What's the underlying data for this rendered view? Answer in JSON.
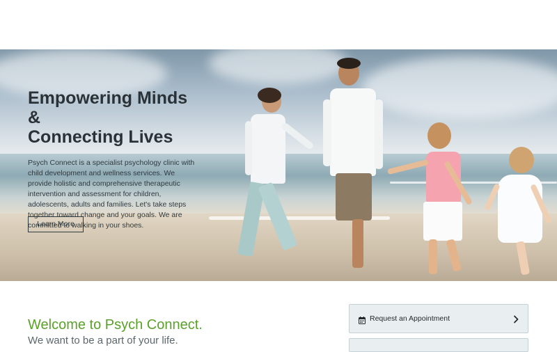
{
  "hero": {
    "title_line1": "Empowering Minds &",
    "title_line2": "Connecting Lives",
    "description": "Psych Connect is a specialist psychology clinic with child development and wellness services. We provide holistic and comprehensive therapeutic intervention and assessment for children, adolescents, adults and families. Let's take steps together toward change and your goals. We are committed to walking in your shoes.",
    "cta_label": "Learn More"
  },
  "welcome": {
    "title": "Welcome to Psych Connect.",
    "subtitle": "We want to be a part of your life."
  },
  "sidebar": {
    "appointment_label": "Request an Appointment",
    "appointment_icon": "calendar-icon",
    "chevron_icon": "chevron-right-icon"
  },
  "colors": {
    "accent_green": "#5aa12a",
    "card_background": "#e9eff1",
    "text_dark": "#2f3a40"
  }
}
